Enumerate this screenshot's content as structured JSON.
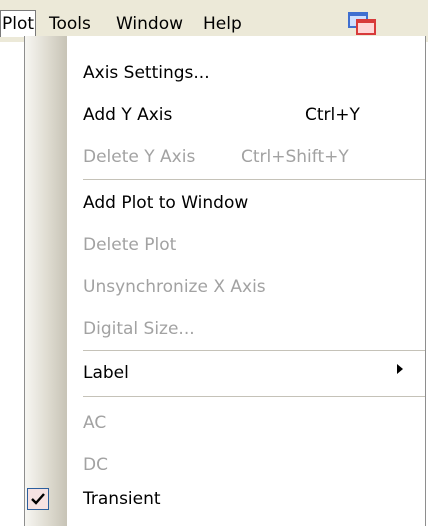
{
  "menubar": {
    "items": [
      {
        "label": "Plot",
        "active": true
      },
      {
        "label": "Tools"
      },
      {
        "label": "Window"
      },
      {
        "label": "Help"
      }
    ],
    "icon": "tile-windows-icon"
  },
  "menu": {
    "items": [
      {
        "label": "Axis Settings...",
        "enabled": true
      },
      {
        "label": "Add Y Axis",
        "shortcut": "Ctrl+Y",
        "enabled": true
      },
      {
        "label": "Delete Y Axis",
        "shortcut": "Ctrl+Shift+Y",
        "enabled": false
      },
      {
        "label": "Add Plot to Window",
        "enabled": true
      },
      {
        "label": "Delete Plot",
        "enabled": false
      },
      {
        "label": "Unsynchronize X Axis",
        "enabled": false
      },
      {
        "label": "Digital Size...",
        "enabled": false
      },
      {
        "label": "Label",
        "submenu": true,
        "enabled": true
      },
      {
        "label": "AC",
        "enabled": false
      },
      {
        "label": "DC",
        "enabled": false
      },
      {
        "label": "Transient",
        "checked": true,
        "enabled": true
      }
    ]
  },
  "colors": {
    "menubar_bg": "#ece9d8",
    "disabled_text": "#a2a2a2",
    "check_bg": "#f6e2e2",
    "check_border": "#2c5f9e",
    "icon_blue": "#3f6fd0",
    "icon_red": "#d83a3a"
  }
}
